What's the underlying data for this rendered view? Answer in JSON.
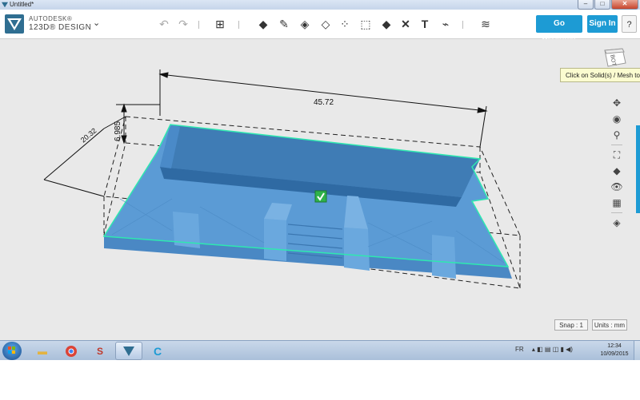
{
  "window": {
    "title": "Untitled*",
    "minimize": "–",
    "maximize": "□",
    "close": "✕"
  },
  "app": {
    "brand_line1": "AUTODESK®",
    "brand_line2": "123D® DESIGN",
    "menu_chevron": "⌄"
  },
  "toolbar": {
    "icons": [
      "undo-icon",
      "redo-icon",
      "primitives-icon",
      "sketch-icon",
      "construct-icon",
      "modify-icon",
      "pattern-icon",
      "group-icon",
      "combine-icon",
      "measure-icon",
      "text-icon",
      "snap-icon",
      "material-icon"
    ],
    "go_premium": "Go Premium",
    "sign_in": "Sign In",
    "help": "?"
  },
  "viewport": {
    "tooltip": "Click on Solid(s) / Mesh to",
    "dimension_length": "45.72",
    "dimension_height": "6.985",
    "dimension_depth": "20.32",
    "snap": "Snap : 1",
    "units": "Units : mm",
    "viewcube_face": "BOT",
    "model_color": "#5b9bd5",
    "edge_highlight": "#2ee8b0"
  },
  "taskbar": {
    "language": "FR",
    "time": "12:34",
    "date": "10/09/2015"
  }
}
